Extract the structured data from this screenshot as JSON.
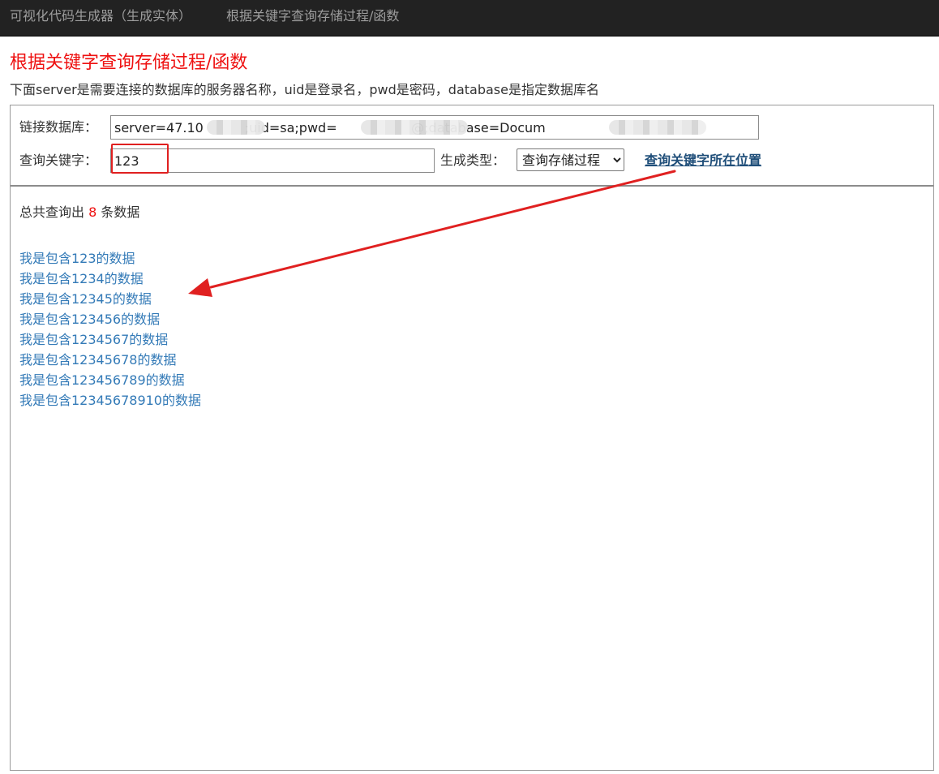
{
  "nav": {
    "home": "可视化代码生成器（生成实体）",
    "search": "根据关键字查询存储过程/函数"
  },
  "page": {
    "title": "根据关键字查询存储过程/函数",
    "description": "下面server是需要连接的数据库的服务器名称，uid是登录名，pwd是密码，database是指定数据库名"
  },
  "form": {
    "conn_label": "链接数据库：",
    "conn_value": "server=47.10          ;uid=sa;pwd=                  @;database=Docum",
    "keyword_label": "查询关键字：",
    "keyword_value": "123",
    "type_label": "生成类型：",
    "type_selected": "查询存储过程",
    "locate_link": "查询关键字所在位置"
  },
  "results": {
    "prefix": "总共查询出 ",
    "count": "8",
    "suffix": " 条数据",
    "items": [
      "我是包含123的数据",
      "我是包含1234的数据",
      "我是包含12345的数据",
      "我是包含123456的数据",
      "我是包含1234567的数据",
      "我是包含12345678的数据",
      "我是包含123456789的数据",
      "我是包含12345678910的数据"
    ]
  },
  "colors": {
    "navbar": "#222222",
    "title": "#ee1111",
    "link": "#337ab7",
    "annotation": "#e02020"
  }
}
